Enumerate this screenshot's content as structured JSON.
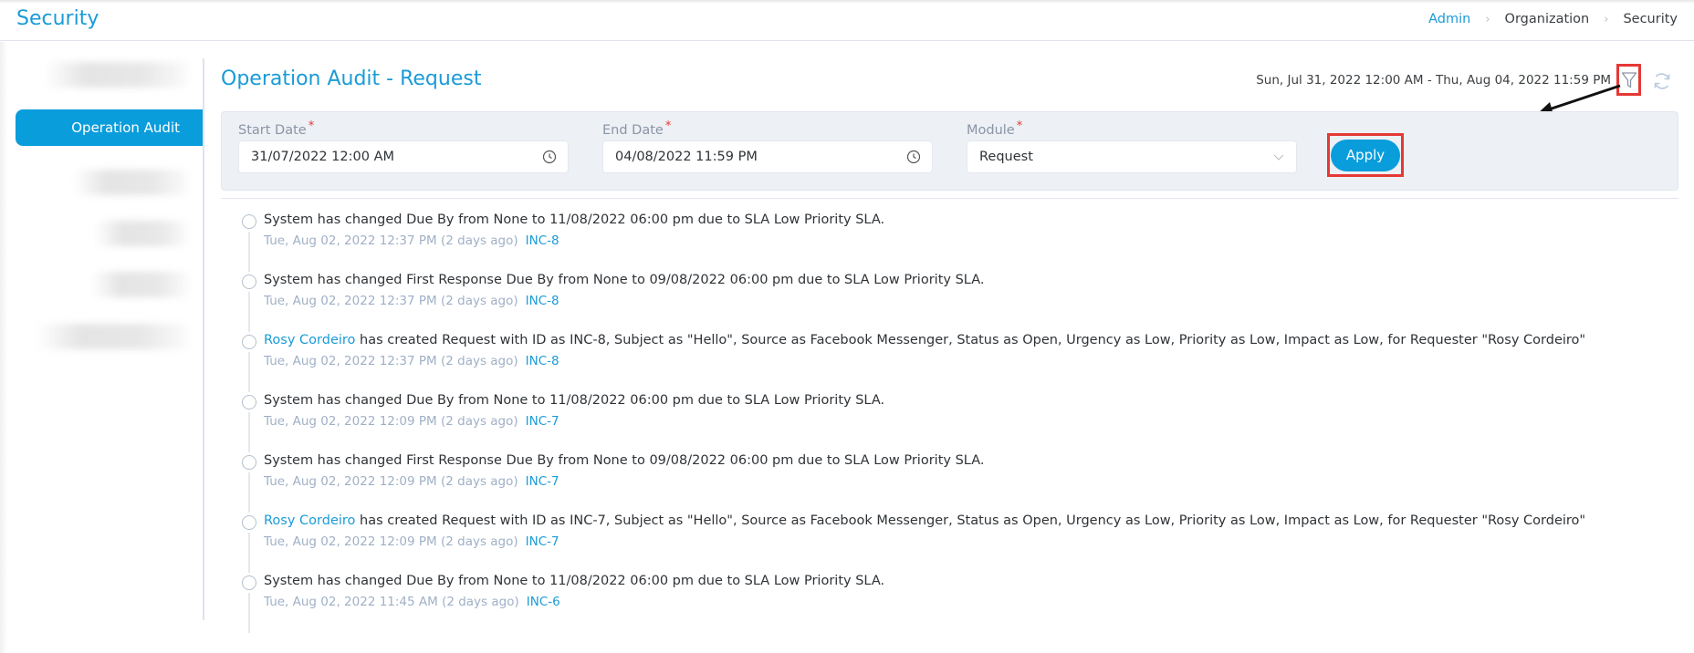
{
  "header": {
    "title": "Security",
    "breadcrumb": [
      {
        "label": "Admin",
        "link": true
      },
      {
        "label": "Organization",
        "link": false
      },
      {
        "label": "Security",
        "link": false
      }
    ],
    "breadcrumb_separator": "›"
  },
  "sidebar": {
    "active_item": "Operation Audit",
    "blurred_items_count": 5
  },
  "main": {
    "title": "Operation Audit - Request",
    "date_range_text": "Sun, Jul 31, 2022 12:00 AM - Thu, Aug 04, 2022 11:59 PM",
    "filter_icon": "funnel-icon",
    "refresh_icon": "refresh-icon"
  },
  "filter": {
    "start_date": {
      "label": "Start Date",
      "required": "*",
      "value": "31/07/2022 12:00 AM",
      "icon": "clock-icon"
    },
    "end_date": {
      "label": "End Date",
      "required": "*",
      "value": "04/08/2022 11:59 PM",
      "icon": "clock-icon"
    },
    "module": {
      "label": "Module",
      "required": "*",
      "value": "Request",
      "icon": "chevron-down-icon"
    },
    "apply_label": "Apply"
  },
  "audit_entries": [
    {
      "actor": "",
      "message": "System has changed Due By from None to 11/08/2022 06:00 pm due to SLA Low Priority SLA.",
      "timestamp": "Tue, Aug 02, 2022 12:37 PM (2 days ago)",
      "ref": "INC-8"
    },
    {
      "actor": "",
      "message": "System has changed First Response Due By from None to 09/08/2022 06:00 pm due to SLA Low Priority SLA.",
      "timestamp": "Tue, Aug 02, 2022 12:37 PM (2 days ago)",
      "ref": "INC-8"
    },
    {
      "actor": "Rosy Cordeiro",
      "message": " has created Request with ID as INC-8, Subject as \"Hello\", Source as Facebook Messenger, Status as Open, Urgency as Low, Priority as Low, Impact as Low, for Requester \"Rosy Cordeiro\"",
      "timestamp": "Tue, Aug 02, 2022 12:37 PM (2 days ago)",
      "ref": "INC-8"
    },
    {
      "actor": "",
      "message": "System has changed Due By from None to 11/08/2022 06:00 pm due to SLA Low Priority SLA.",
      "timestamp": "Tue, Aug 02, 2022 12:09 PM (2 days ago)",
      "ref": "INC-7"
    },
    {
      "actor": "",
      "message": "System has changed First Response Due By from None to 09/08/2022 06:00 pm due to SLA Low Priority SLA.",
      "timestamp": "Tue, Aug 02, 2022 12:09 PM (2 days ago)",
      "ref": "INC-7"
    },
    {
      "actor": "Rosy Cordeiro",
      "message": " has created Request with ID as INC-7, Subject as \"Hello\", Source as Facebook Messenger, Status as Open, Urgency as Low, Priority as Low, Impact as Low, for Requester \"Rosy Cordeiro\"",
      "timestamp": "Tue, Aug 02, 2022 12:09 PM (2 days ago)",
      "ref": "INC-7"
    },
    {
      "actor": "",
      "message": "System has changed Due By from None to 11/08/2022 06:00 pm due to SLA Low Priority SLA.",
      "timestamp": "Tue, Aug 02, 2022 11:45 AM (2 days ago)",
      "ref": "INC-6"
    }
  ],
  "colors": {
    "accent": "#0a9ddc",
    "link": "#1a9bd7",
    "required": "#e53935",
    "annotation_box": "#e53935",
    "panel_bg": "#edf0f5"
  }
}
